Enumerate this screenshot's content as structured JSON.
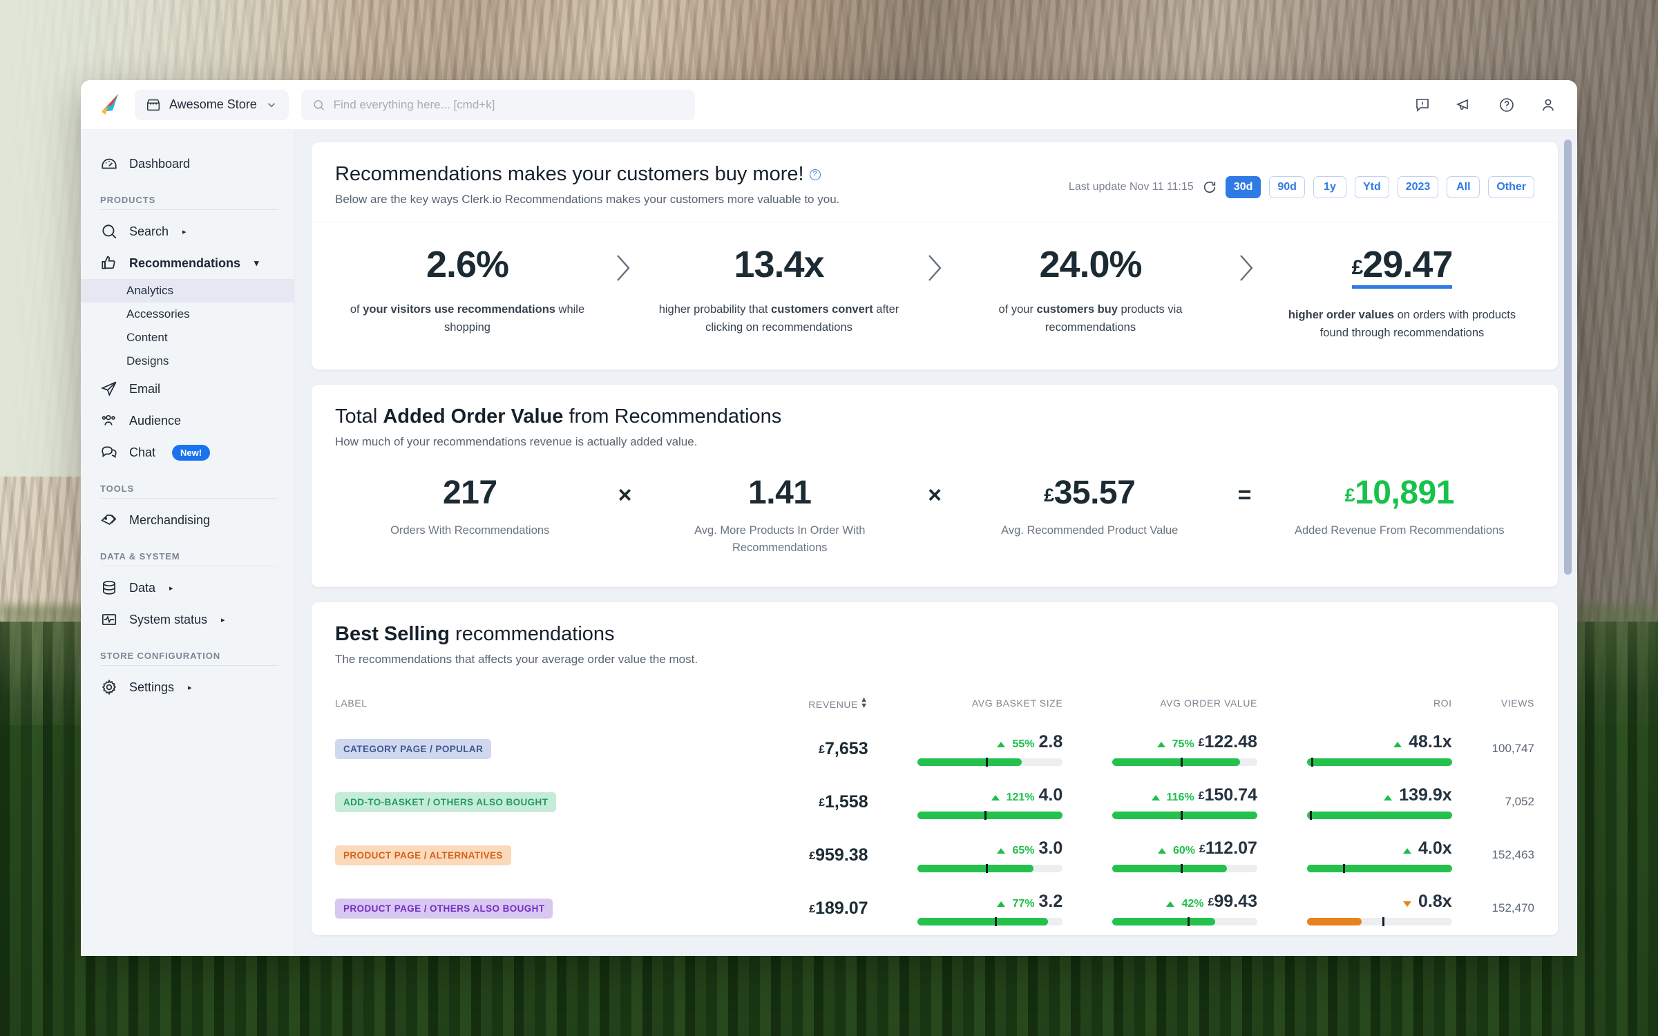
{
  "topbar": {
    "logo_name": "clerk-logo",
    "store": {
      "name": "Awesome Store",
      "icon": "store-icon",
      "chevron": "chevron-down-icon"
    },
    "search": {
      "placeholder": "Find everything here... [cmd+k]",
      "value": "",
      "icon": "search-icon"
    },
    "actions": [
      {
        "name": "alert-icon",
        "label": "Alerts"
      },
      {
        "name": "megaphone-icon",
        "label": "Announcements"
      },
      {
        "name": "help-icon",
        "label": "Help"
      },
      {
        "name": "user-account-icon",
        "label": "Account"
      }
    ]
  },
  "sidebar": {
    "dashboard": {
      "label": "Dashboard",
      "icon": "dashboard-icon"
    },
    "sections": [
      {
        "label": "PRODUCTS",
        "items": [
          {
            "label": "Search",
            "icon": "search-icon",
            "caret": "▸",
            "bold": false
          },
          {
            "label": "Recommendations",
            "icon": "thumbs-up-icon",
            "caret": "▾",
            "bold": true,
            "children": [
              {
                "label": "Analytics",
                "active": true
              },
              {
                "label": "Accessories",
                "active": false
              },
              {
                "label": "Content",
                "active": false
              },
              {
                "label": "Designs",
                "active": false
              }
            ]
          },
          {
            "label": "Email",
            "icon": "paper-plane-icon",
            "caret": "",
            "bold": false
          },
          {
            "label": "Audience",
            "icon": "audience-icon",
            "caret": "",
            "bold": false
          },
          {
            "label": "Chat",
            "icon": "chat-icon",
            "caret": "",
            "bold": false,
            "badge": "New!"
          }
        ]
      },
      {
        "label": "TOOLS",
        "items": [
          {
            "label": "Merchandising",
            "icon": "tag-icon",
            "caret": "",
            "bold": false
          }
        ]
      },
      {
        "label": "DATA & SYSTEM",
        "items": [
          {
            "label": "Data",
            "icon": "database-icon",
            "caret": "▸",
            "bold": false
          },
          {
            "label": "System status",
            "icon": "pulse-icon",
            "caret": "▸",
            "bold": false
          }
        ]
      },
      {
        "label": "STORE CONFIGURATION",
        "items": [
          {
            "label": "Settings",
            "icon": "gear-icon",
            "caret": "▸",
            "bold": false
          }
        ]
      }
    ]
  },
  "hero": {
    "title_plain": "Recommendations makes your customers buy more!",
    "info_icon": "info-icon",
    "subtitle": "Below are the key ways Clerk.io Recommendations makes your customers more valuable to you.",
    "last_update": "Last update Nov 11 11:15",
    "refresh_icon": "refresh-icon",
    "range_chips": [
      {
        "label": "30d",
        "active": true
      },
      {
        "label": "90d",
        "active": false
      },
      {
        "label": "1y",
        "active": false
      },
      {
        "label": "Ytd",
        "active": false
      },
      {
        "label": "2023",
        "active": false
      },
      {
        "label": "All",
        "active": false
      },
      {
        "label": "Other",
        "active": false
      }
    ],
    "kpis": [
      {
        "value": "2.6%",
        "currency": "",
        "underline": false,
        "caption_html": "of <b>your visitors use recommendations</b> while shopping"
      },
      {
        "value": "13.4x",
        "currency": "",
        "underline": false,
        "caption_html": "higher probability that <b>customers convert</b> after clicking on recommendations"
      },
      {
        "value": "24.0%",
        "currency": "",
        "underline": false,
        "caption_html": "of your <b>customers buy</b> products via recommendations"
      },
      {
        "value": "29.47",
        "currency": "£",
        "underline": true,
        "caption_html": "<b>higher order values</b> on orders with products found through recommendations"
      }
    ]
  },
  "added_value": {
    "title_prefix": "Total ",
    "title_bold": "Added Order Value",
    "title_suffix": " from Recommendations",
    "subtitle": "How much of your recommendations revenue is actually added value.",
    "cells": [
      {
        "value": "217",
        "currency": "",
        "label": "Orders With Recommendations",
        "green": false
      },
      {
        "op": "×"
      },
      {
        "value": "1.41",
        "currency": "",
        "label": "Avg. More Products In Order With Recommendations",
        "green": false
      },
      {
        "op": "×"
      },
      {
        "value": "35.57",
        "currency": "£",
        "label": "Avg. Recommended Product Value",
        "green": false
      },
      {
        "op": "="
      },
      {
        "value": "10,891",
        "currency": "£",
        "label": "Added Revenue From Recommendations",
        "green": true
      }
    ]
  },
  "best_selling": {
    "title_bold": "Best Selling",
    "title_rest": " recommendations",
    "subtitle": "The recommendations that affects your average order value the most.",
    "columns": [
      "LABEL",
      "REVENUE",
      "AVG BASKET SIZE",
      "AVG ORDER VALUE",
      "ROI",
      "VIEWS"
    ],
    "sort_column": "REVENUE",
    "rows": [
      {
        "label": "CATEGORY PAGE / POPULAR",
        "tag_bg": "#cfd8ee",
        "tag_fg": "#3d5692",
        "revenue": "7,653",
        "revenue_currency": "£",
        "basket": {
          "pct": "55%",
          "dir": "up",
          "value": "2.8",
          "currency": "",
          "fill": 72,
          "tick": 47
        },
        "order_value": {
          "pct": "75%",
          "dir": "up",
          "value": "122.48",
          "currency": "£",
          "fill": 88,
          "tick": 47
        },
        "roi": {
          "pct": "",
          "dir": "up",
          "value": "48.1x",
          "currency": "",
          "fill": 100,
          "tick": 3
        },
        "views": "100,747"
      },
      {
        "label": "ADD-TO-BASKET / OTHERS ALSO BOUGHT",
        "tag_bg": "#c6ecd9",
        "tag_fg": "#1e9a68",
        "revenue": "1,558",
        "revenue_currency": "£",
        "basket": {
          "pct": "121%",
          "dir": "up",
          "value": "4.0",
          "currency": "",
          "fill": 100,
          "tick": 46
        },
        "order_value": {
          "pct": "116%",
          "dir": "up",
          "value": "150.74",
          "currency": "£",
          "fill": 100,
          "tick": 47
        },
        "roi": {
          "pct": "",
          "dir": "up",
          "value": "139.9x",
          "currency": "",
          "fill": 100,
          "tick": 2
        },
        "views": "7,052"
      },
      {
        "label": "PRODUCT PAGE / ALTERNATIVES",
        "tag_bg": "#fbd9bb",
        "tag_fg": "#d2621a",
        "revenue": "959.38",
        "revenue_currency": "£",
        "basket": {
          "pct": "65%",
          "dir": "up",
          "value": "3.0",
          "currency": "",
          "fill": 80,
          "tick": 47
        },
        "order_value": {
          "pct": "60%",
          "dir": "up",
          "value": "112.07",
          "currency": "£",
          "fill": 79,
          "tick": 47
        },
        "roi": {
          "pct": "",
          "dir": "up",
          "value": "4.0x",
          "currency": "",
          "fill": 100,
          "tick": 25
        },
        "views": "152,463"
      },
      {
        "label": "PRODUCT PAGE / OTHERS ALSO BOUGHT",
        "tag_bg": "#d8c7f0",
        "tag_fg": "#7230c6",
        "revenue": "189.07",
        "revenue_currency": "£",
        "basket": {
          "pct": "77%",
          "dir": "up",
          "value": "3.2",
          "currency": "",
          "fill": 90,
          "tick": 53
        },
        "order_value": {
          "pct": "42%",
          "dir": "up",
          "value": "99.43",
          "currency": "£",
          "fill": 71,
          "tick": 52
        },
        "roi": {
          "pct": "",
          "dir": "down",
          "value": "0.8x",
          "currency": "",
          "fill": 38,
          "tick": 52
        },
        "views": "152,470"
      }
    ]
  }
}
